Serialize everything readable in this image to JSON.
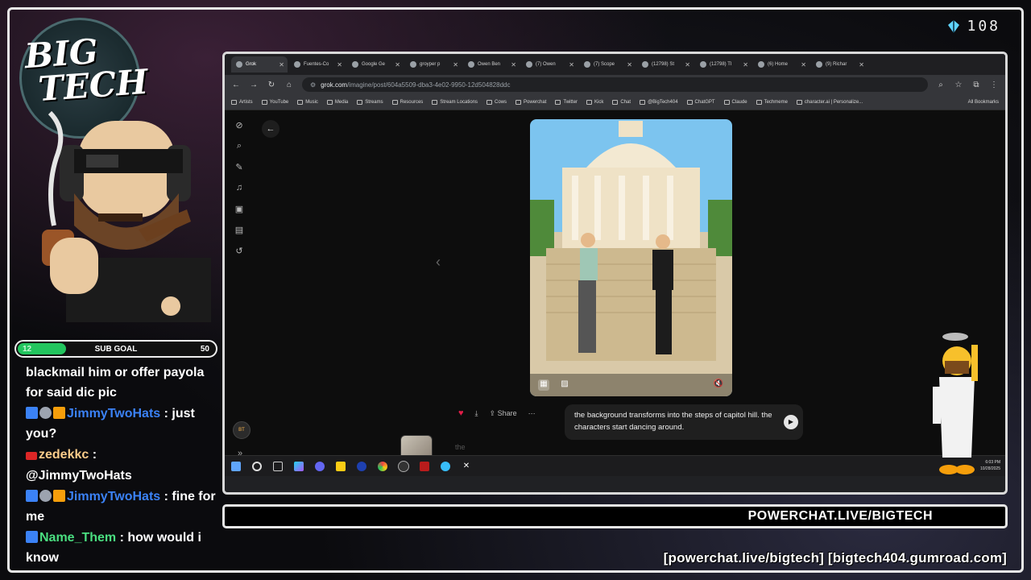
{
  "overlay": {
    "logo": {
      "line1": "BIG",
      "line2": "TECH"
    },
    "viewer_count": "108",
    "sub_goal": {
      "label": "SUB GOAL",
      "current": "12",
      "target": "50",
      "progress": 0.24
    },
    "chat": [
      {
        "user": "",
        "text": "blackmail him or offer payola for said dic pic",
        "color": "#ffffff",
        "badges": []
      },
      {
        "user": "JimmyTwoHats",
        "text": ": just you?",
        "color": "#3b82f6",
        "badges": [
          "blue",
          "gray",
          "gold"
        ]
      },
      {
        "user": "zedekkc",
        "text": ":",
        "color": "#facc8a",
        "badges": [
          "red"
        ]
      },
      {
        "user": "",
        "text": "@JimmyTwoHats",
        "color": "#ffffff",
        "badges": []
      },
      {
        "user": "JimmyTwoHats",
        "text": ": fine for me",
        "color": "#3b82f6",
        "badges": [
          "blue",
          "gray",
          "gold"
        ]
      },
      {
        "user": "Name_Them",
        "text": ": how would i know",
        "color": "#4ade80",
        "badges": [
          "blue"
        ]
      }
    ],
    "footer_banner": "POWERCHAT.LIVE/BIGTECH",
    "footer_links": "[powerchat.live/bigtech] [bigtech404.gumroad.com]"
  },
  "browser": {
    "tabs": [
      {
        "label": "Grok",
        "active": true
      },
      {
        "label": "Fuentes-Co",
        "active": false
      },
      {
        "label": "Google Ge",
        "active": false
      },
      {
        "label": "groyper p",
        "active": false
      },
      {
        "label": "Owen Ben",
        "active": false
      },
      {
        "label": "(7) Owen",
        "active": false
      },
      {
        "label": "(7) Scope",
        "active": false
      },
      {
        "label": "(12798) St",
        "active": false
      },
      {
        "label": "(12798) Tl",
        "active": false
      },
      {
        "label": "(6) Home",
        "active": false
      },
      {
        "label": "(9) Richar",
        "active": false
      }
    ],
    "url_host": "grok.com",
    "url_path": "/imagine/post/604a5509-dba3-4e02-9950-12d504828ddc",
    "bookmarks": [
      "Artists",
      "YouTube",
      "Music",
      "Media",
      "Streams",
      "Resources",
      "Stream Locations",
      "Cows",
      "Powerchat",
      "Twitter",
      "Kick",
      "Chat",
      "@BigTech404",
      "ChatGPT",
      "Claude",
      "Techmeme",
      "character.ai | Personalize..."
    ],
    "all_bookmarks": "All Bookmarks"
  },
  "grok_page": {
    "prompt": "the background transforms into the steps of capitol hill. the characters start dancing around.",
    "share_label": "Share",
    "compose_placeholder": "the",
    "clock_time": "6:03 PM",
    "clock_date": "10/28/2025"
  },
  "colors": {
    "accent": "#22c55e",
    "frame": "#e8e8e8",
    "heart": "#e11d48"
  }
}
